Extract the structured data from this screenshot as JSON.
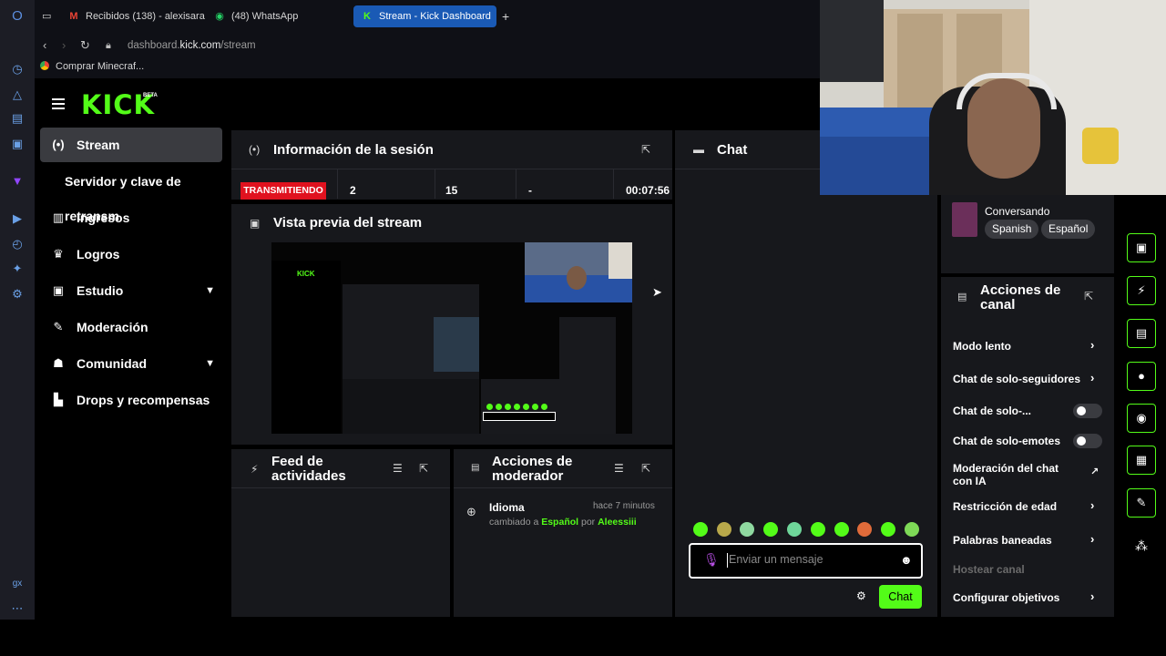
{
  "browser": {
    "tabs": [
      {
        "label": "Recibidos (138) - alexisara",
        "icon": "gmail-icon"
      },
      {
        "label": "(48) WhatsApp",
        "icon": "whatsapp-icon"
      },
      {
        "label": "Stream - Kick Dashboard",
        "icon": "kick-icon",
        "active": true
      }
    ],
    "url_prefix": "dashboard.",
    "url_domain": "kick.com",
    "url_path": "/stream",
    "bookmark": "Comprar Minecraf..."
  },
  "sidebar": {
    "logo": "KICK",
    "beta": "BETA",
    "items": [
      {
        "label": "Stream",
        "icon": "broadcast-icon"
      },
      {
        "label": "Servidor y clave de retransm",
        "icon": ""
      },
      {
        "label": "Ingresos",
        "icon": "bar-chart-icon"
      },
      {
        "label": "Logros",
        "icon": "trophy-icon"
      },
      {
        "label": "Estudio",
        "icon": "studio-icon"
      },
      {
        "label": "Moderación",
        "icon": "wrench-icon"
      },
      {
        "label": "Comunidad",
        "icon": "community-icon"
      },
      {
        "label": "Drops y recompensas",
        "icon": "drops-icon"
      }
    ]
  },
  "session": {
    "title": "Información de la sesión",
    "status": "TRANSMITIENDO",
    "viewers": "2",
    "followers": "15",
    "other": "-",
    "duration": "00:07:56"
  },
  "preview": {
    "title": "Vista previa del stream"
  },
  "feed": {
    "title": "Feed de actividades"
  },
  "mod_actions": {
    "title": "Acciones de moderador",
    "entry": {
      "type": "Idioma",
      "time": "hace 7 minutos",
      "prefix": "cambiado a",
      "value": "Español",
      "by": "por",
      "user": "Aleessiii"
    }
  },
  "chat": {
    "title": "Chat",
    "placeholder": "Enviar un mensaje",
    "send_label": "Chat"
  },
  "stream_info": {
    "category": "Conversando",
    "tags": [
      "Spanish",
      "Español"
    ]
  },
  "channel_actions": {
    "title_line1": "Acciones de",
    "title_line2": "canal",
    "items": [
      {
        "label": "Modo lento",
        "control": "chevron"
      },
      {
        "label": "Chat de solo-seguidores",
        "control": "chevron"
      },
      {
        "label": "Chat de solo-...",
        "control": "toggle"
      },
      {
        "label": "Chat de solo-emotes",
        "control": "toggle"
      },
      {
        "label": "Moderación del chat con IA",
        "control": "external"
      },
      {
        "label": "Restricción de edad",
        "control": "chevron"
      },
      {
        "label": "Palabras baneadas",
        "control": "chevron"
      },
      {
        "label": "Hostear canal",
        "control": "disabled"
      },
      {
        "label": "Configurar objetivos",
        "control": "chevron"
      }
    ]
  },
  "colors": {
    "kick_green": "#53fc18",
    "live_red": "#e0121f",
    "panel": "#17181c",
    "accent_tab": "#1a5ab5"
  }
}
